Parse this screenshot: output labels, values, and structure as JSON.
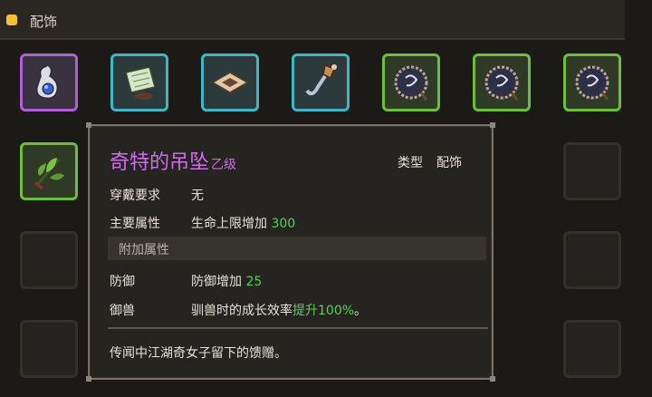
{
  "header": {
    "title": "配饰"
  },
  "inventory": {
    "slots": [
      {
        "icon": "pendant-icon",
        "rarity": "purple"
      },
      {
        "icon": "scroll-icon",
        "rarity": "blue"
      },
      {
        "icon": "cloth-icon",
        "rarity": "blue"
      },
      {
        "icon": "hook-icon",
        "rarity": "blue"
      },
      {
        "icon": "amulet-icon",
        "rarity": "green"
      },
      {
        "icon": "amulet-icon",
        "rarity": "green"
      },
      {
        "icon": "amulet-icon",
        "rarity": "green"
      },
      {
        "icon": "herb-icon",
        "rarity": "green"
      }
    ]
  },
  "tooltip": {
    "name": "奇特的吊坠",
    "grade": "乙级",
    "type_label": "类型",
    "type_value": "配饰",
    "requirement_label": "穿戴要求",
    "requirement_value": "无",
    "main_attr_label": "主要属性",
    "main_attr_text": "生命上限增加",
    "main_attr_num": "300",
    "extra_section": "附加属性",
    "defense_label": "防御",
    "defense_text": "防御增加",
    "defense_num": "25",
    "taming_label": "御兽",
    "taming_text": "驯兽时的成长效率",
    "taming_highlight": "提升100%",
    "taming_suffix": "。",
    "description": "传闻中江湖奇女子留下的馈赠。"
  },
  "colors": {
    "purple": "#b05fd8",
    "blue": "#3fb6c6",
    "green": "#6fbe3a",
    "name": "#cf6ee8",
    "value_green": "#55d05a"
  }
}
